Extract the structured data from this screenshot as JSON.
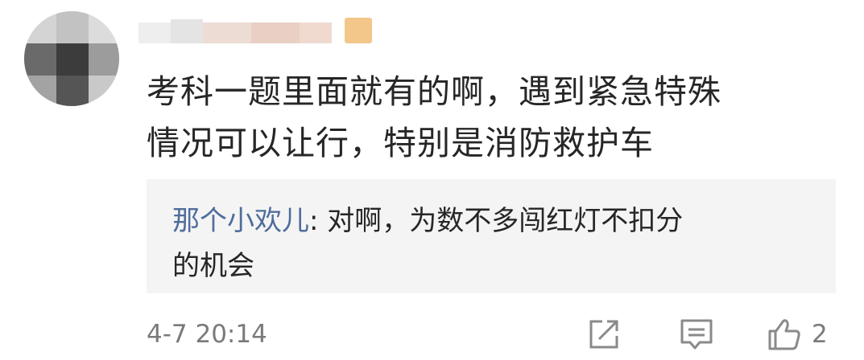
{
  "comment": {
    "author_name": "",
    "text_lines": [
      "考科一题里面就有的啊，遇到紧急特殊",
      "情况可以让行，特别是消防救护车"
    ],
    "reply": {
      "author": "那个小欢儿",
      "separator": ": ",
      "text_line1": "对啊，为数不多闯红灯不扣分",
      "text_line2": "的机会"
    },
    "timestamp": "4-7 20:14",
    "like_count": "2"
  },
  "icons": {
    "share": "share-icon",
    "comment": "comment-icon",
    "like": "thumbs-up-icon"
  },
  "colors": {
    "text": "#262626",
    "reply_author": "#4f6d9c",
    "meta": "#7a7a7a",
    "reply_background": "#f4f4f4",
    "icon": "#8a8a8a"
  }
}
